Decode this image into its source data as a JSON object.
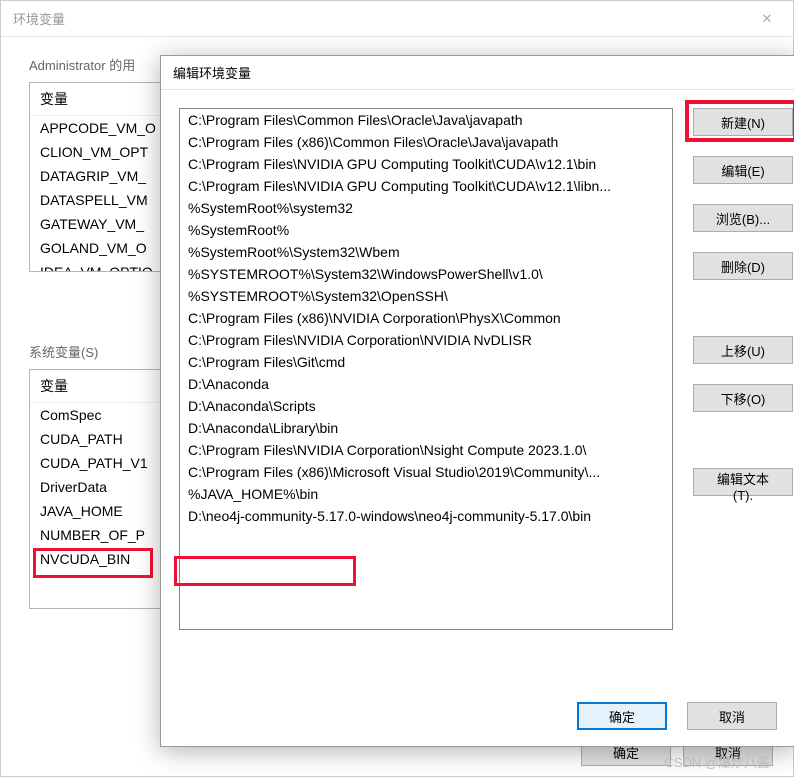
{
  "back": {
    "title": "环境变量",
    "admin_label": "Administrator 的用",
    "user_header": "变量",
    "user_items": [
      "APPCODE_VM_O",
      "CLION_VM_OPT",
      "DATAGRIP_VM_",
      "DATASPELL_VM",
      "GATEWAY_VM_",
      "GOLAND_VM_O",
      "IDEA_VM_OPTIO"
    ],
    "sys_label": "系统变量(S)",
    "sys_header": "变量",
    "sys_items": [
      "ComSpec",
      "CUDA_PATH",
      "CUDA_PATH_V1",
      "DriverData",
      "JAVA_HOME",
      "NUMBER_OF_P",
      "NVCUDA_BIN"
    ],
    "ok": "确定",
    "cancel": "取消"
  },
  "front": {
    "title": "编辑环境变量",
    "items": [
      "C:\\Program Files\\Common Files\\Oracle\\Java\\javapath",
      "C:\\Program Files (x86)\\Common Files\\Oracle\\Java\\javapath",
      "C:\\Program Files\\NVIDIA GPU Computing Toolkit\\CUDA\\v12.1\\bin",
      "C:\\Program Files\\NVIDIA GPU Computing Toolkit\\CUDA\\v12.1\\libn...",
      "%SystemRoot%\\system32",
      "%SystemRoot%",
      "%SystemRoot%\\System32\\Wbem",
      "%SYSTEMROOT%\\System32\\WindowsPowerShell\\v1.0\\",
      "%SYSTEMROOT%\\System32\\OpenSSH\\",
      "C:\\Program Files (x86)\\NVIDIA Corporation\\PhysX\\Common",
      "C:\\Program Files\\NVIDIA Corporation\\NVIDIA NvDLISR",
      "C:\\Program Files\\Git\\cmd",
      "D:\\Anaconda",
      "D:\\Anaconda\\Scripts",
      "D:\\Anaconda\\Library\\bin",
      "C:\\Program Files\\NVIDIA Corporation\\Nsight Compute 2023.1.0\\",
      "C:\\Program Files (x86)\\Microsoft Visual Studio\\2019\\Community\\...",
      "%JAVA_HOME%\\bin",
      "D:\\neo4j-community-5.17.0-windows\\neo4j-community-5.17.0\\bin"
    ],
    "btn_new": "新建(N)",
    "btn_edit": "编辑(E)",
    "btn_browse": "浏览(B)...",
    "btn_delete": "删除(D)",
    "btn_up": "上移(U)",
    "btn_down": "下移(O)",
    "btn_edit_text": "编辑文本(T).",
    "ok": "确定",
    "cancel": "取消"
  },
  "watermark": "CSDN @爆炒八酱"
}
